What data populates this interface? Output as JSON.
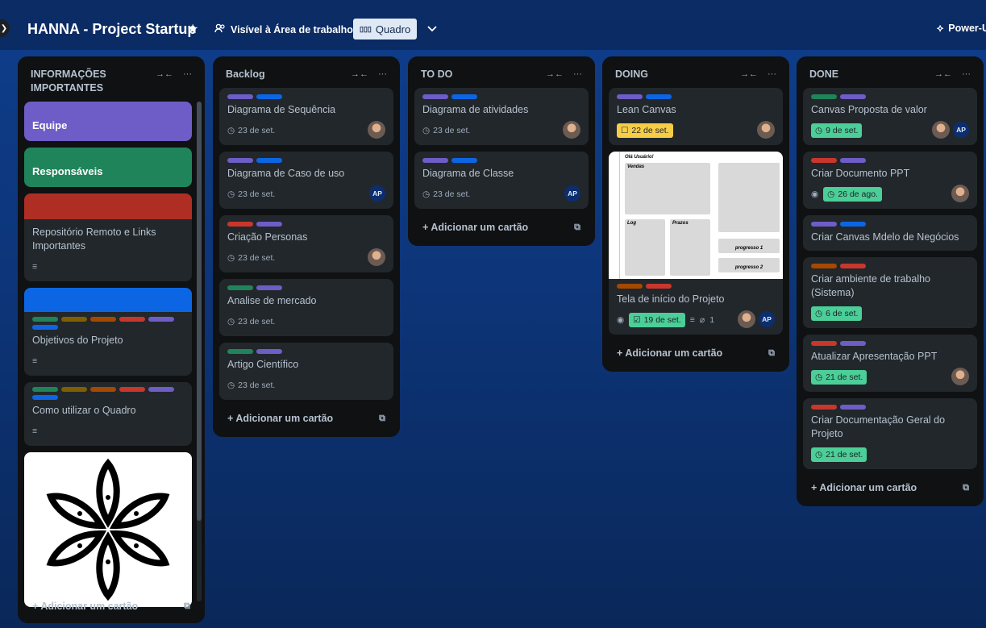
{
  "header": {
    "title": "HANNA - Project Startup",
    "visibility": "Visível à Área de trabalho",
    "view": "Quadro",
    "powerups": "Power-Ups"
  },
  "colors": {
    "green": "#1f845a",
    "olive": "#7f5f01",
    "orange": "#a54800",
    "red": "#c9372c",
    "purple": "#6e5dc6",
    "blue": "#0c66e4"
  },
  "add_card": "Adicionar um cartão",
  "lists": {
    "info": {
      "title": "INFORMAÇÕES IMPORTANTES",
      "cards": {
        "equipe": "Equipe",
        "responsaveis": "Responsáveis",
        "repo": "Repositório Remoto e Links Importantes",
        "objetivos": "Objetivos do Projeto",
        "como": "Como utilizar o Quadro"
      }
    },
    "backlog": {
      "title": "Backlog",
      "cards": [
        {
          "title": "Diagrama de Sequência",
          "due": "23 de set."
        },
        {
          "title": "Diagrama de Caso de uso",
          "due": "23 de set.",
          "member": "AP"
        },
        {
          "title": "Criação Personas",
          "due": "23 de set."
        },
        {
          "title": "Analise de mercado",
          "due": "23 de set."
        },
        {
          "title": "Artigo Científico",
          "due": "23 de set."
        }
      ]
    },
    "todo": {
      "title": "TO DO",
      "cards": [
        {
          "title": "Diagrama de atividades",
          "due": "23 de set."
        },
        {
          "title": "Diagrama de Classe",
          "due": "23 de set.",
          "member": "AP"
        }
      ]
    },
    "doing": {
      "title": "DOING",
      "cards": [
        {
          "title": "Lean Canvas",
          "due": "22 de set."
        },
        {
          "title": "Tela de início do Projeto",
          "due": "19 de set.",
          "attachments": "1",
          "member": "AP"
        }
      ],
      "mockup": {
        "greeting": "Olá Usuário!",
        "vendas": "Vendas",
        "log": "Log",
        "prazos": "Prazos",
        "progresso1": "progresso 1",
        "progresso2": "progresso 2"
      }
    },
    "done": {
      "title": "DONE",
      "cards": [
        {
          "title": "Canvas Proposta de valor",
          "due": "9 de set.",
          "member": "AP"
        },
        {
          "title": "Criar Documento PPT",
          "due": "26 de ago."
        },
        {
          "title": "Criar Canvas Mdelo de Negócios"
        },
        {
          "title": "Criar ambiente de trabalho (Sistema)",
          "due": "6 de set."
        },
        {
          "title": "Atualizar Apresentação PPT",
          "due": "21 de set."
        },
        {
          "title": "Criar Documentação Geral do Projeto",
          "due": "21 de set."
        }
      ]
    }
  }
}
